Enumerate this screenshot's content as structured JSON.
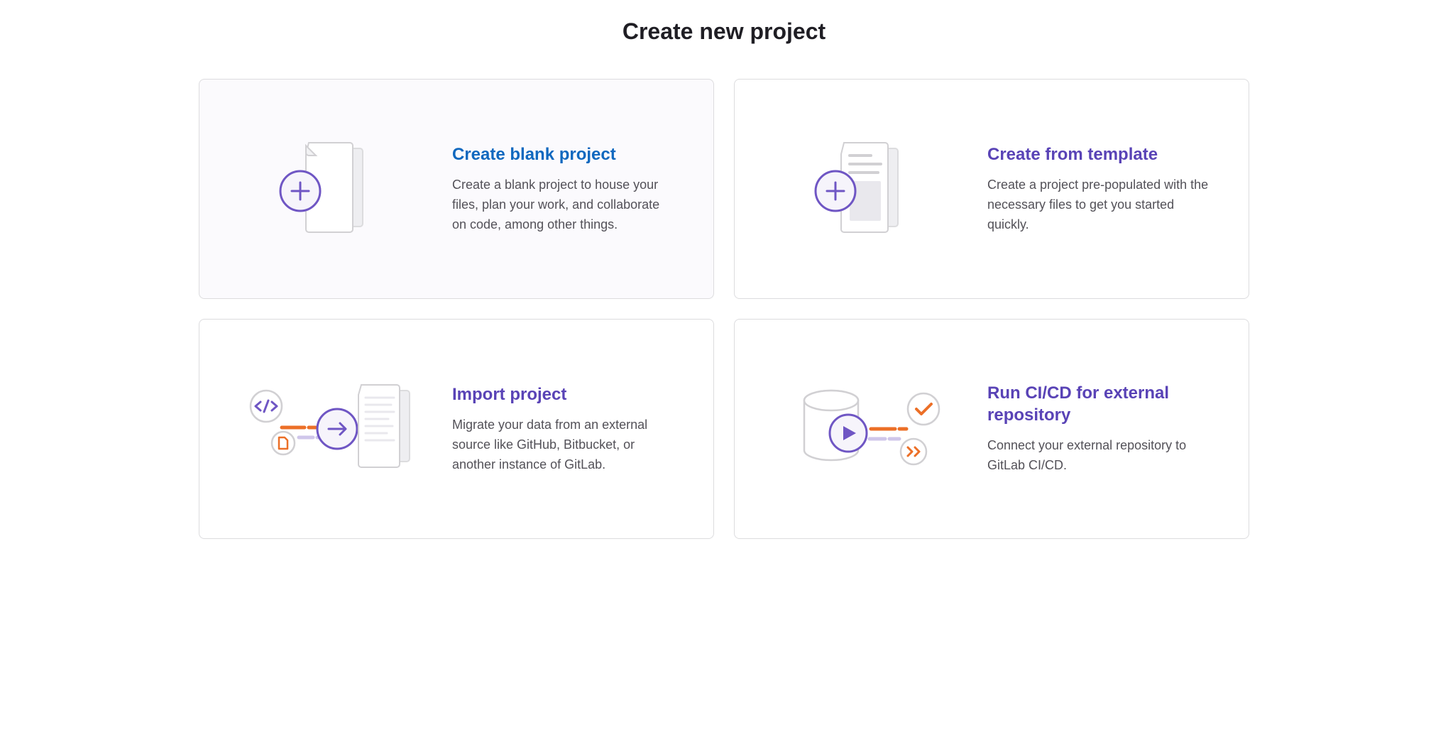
{
  "page": {
    "title": "Create new project"
  },
  "cards": [
    {
      "title": "Create blank project",
      "description": "Create a blank project to house your files, plan your work, and collaborate on code, among other things."
    },
    {
      "title": "Create from template",
      "description": "Create a project pre-populated with the necessary files to get you started quickly."
    },
    {
      "title": "Import project",
      "description": "Migrate your data from an external source like GitHub, Bitbucket, or another instance of GitLab."
    },
    {
      "title": "Run CI/CD for external repository",
      "description": "Connect your external repository to GitLab CI/CD."
    }
  ]
}
